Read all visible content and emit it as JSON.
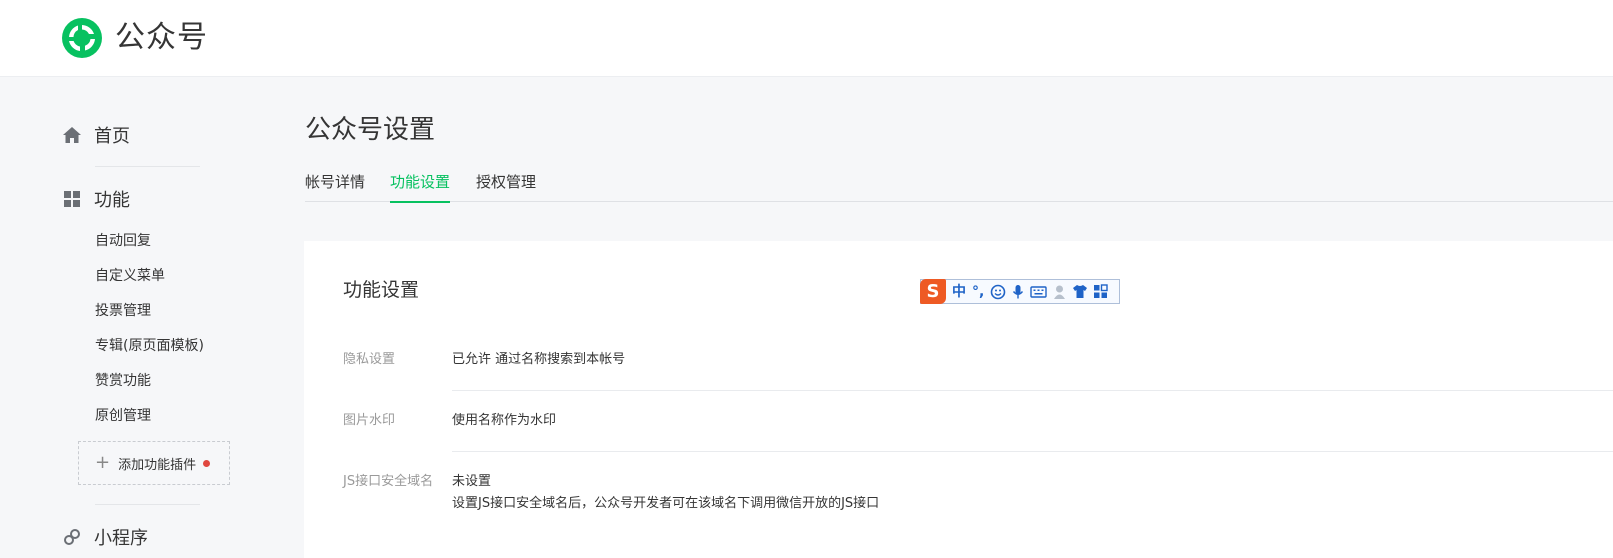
{
  "app": {
    "title": "公众号"
  },
  "sidebar": {
    "home": "首页",
    "features": "功能",
    "feature_items": [
      "自动回复",
      "自定义菜单",
      "投票管理",
      "专辑(原页面模板)",
      "赞赏功能",
      "原创管理"
    ],
    "add_plugin": "添加功能插件",
    "mini_program": "小程序"
  },
  "main": {
    "page_title": "公众号设置",
    "tabs": [
      {
        "label": "帐号详情",
        "active": false
      },
      {
        "label": "功能设置",
        "active": true
      },
      {
        "label": "授权管理",
        "active": false
      }
    ],
    "card_title": "功能设置",
    "rows": [
      {
        "label": "隐私设置",
        "value": "已允许 通过名称搜索到本帐号"
      },
      {
        "label": "图片水印",
        "value": "使用名称作为水印"
      },
      {
        "label": "JS接口安全域名",
        "value": "未设置",
        "desc": "设置JS接口安全域名后，公众号开发者可在该域名下调用微信开放的JS接口"
      }
    ]
  },
  "ime": {
    "logo": "S",
    "lang": "中",
    "punct": "°,"
  },
  "colors": {
    "accent": "#07c160",
    "badge": "#e0473f"
  }
}
